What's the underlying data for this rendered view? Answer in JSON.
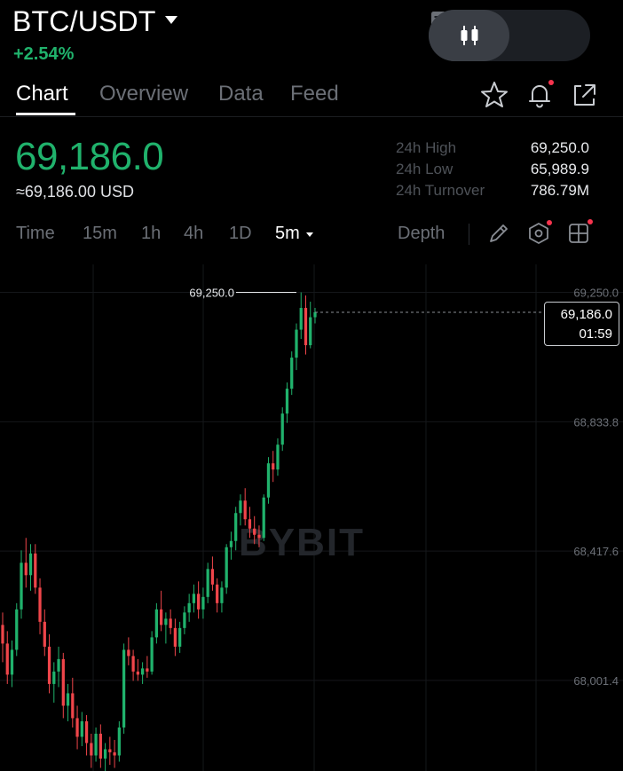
{
  "header": {
    "pair": "BTC/USDT",
    "change": "+2.54%",
    "view_toggle": {
      "left_icon": "candlestick-icon",
      "right_icon": "document-icon",
      "active": "left"
    }
  },
  "tabs": [
    {
      "label": "Chart",
      "active": true
    },
    {
      "label": "Overview",
      "active": false
    },
    {
      "label": "Data",
      "active": false
    },
    {
      "label": "Feed",
      "active": false
    }
  ],
  "header_icons": [
    "star-icon",
    "bell-icon",
    "share-icon"
  ],
  "ticker": {
    "last_price": "69,186.0",
    "usd_equiv": "≈69,186.00 USD",
    "stats": [
      {
        "label": "24h High",
        "value": "69,250.0"
      },
      {
        "label": "24h Low",
        "value": "65,989.9"
      },
      {
        "label": "24h Turnover",
        "value": "786.79M"
      }
    ]
  },
  "intervals": [
    {
      "label": "Time",
      "active": false
    },
    {
      "label": "15m",
      "active": false
    },
    {
      "label": "1h",
      "active": false
    },
    {
      "label": "4h",
      "active": false
    },
    {
      "label": "1D",
      "active": false
    },
    {
      "label": "5m",
      "active": true
    }
  ],
  "toolbar": {
    "depth_label": "Depth",
    "icons": [
      "pencil-icon",
      "indicator-icon",
      "layout-grid-icon"
    ]
  },
  "colors": {
    "up": "#20b26c",
    "down": "#ef454a",
    "accent_dot": "#f7344e"
  },
  "chart_data": {
    "type": "candlestick",
    "watermark": "BYBIT",
    "y_ticks": [
      "69,250.0",
      "68,833.8",
      "68,417.6",
      "68,001.4"
    ],
    "y_tick_values": [
      69250.0,
      68833.8,
      68417.6,
      68001.4
    ],
    "ylim": [
      67710,
      69340
    ],
    "high_marker": {
      "label": "69,250.0",
      "value": 69250.0
    },
    "current_price": {
      "price": "69,186.0",
      "value": 69186.0,
      "countdown": "01:59"
    },
    "candles": [
      [
        68180,
        68220,
        68060,
        68120
      ],
      [
        68120,
        68160,
        67990,
        68020
      ],
      [
        68020,
        68130,
        67980,
        68100
      ],
      [
        68100,
        68250,
        68080,
        68230
      ],
      [
        68230,
        68420,
        68200,
        68380
      ],
      [
        68380,
        68460,
        68300,
        68340
      ],
      [
        68340,
        68440,
        68290,
        68410
      ],
      [
        68410,
        68440,
        68280,
        68300
      ],
      [
        68300,
        68330,
        68150,
        68190
      ],
      [
        68190,
        68230,
        68080,
        68110
      ],
      [
        68110,
        68150,
        67960,
        67990
      ],
      [
        67990,
        68060,
        67930,
        68030
      ],
      [
        68030,
        68110,
        67980,
        68070
      ],
      [
        68070,
        68090,
        67880,
        67920
      ],
      [
        67920,
        67990,
        67870,
        67960
      ],
      [
        67960,
        68010,
        67850,
        67880
      ],
      [
        67880,
        67920,
        67780,
        67820
      ],
      [
        67820,
        67900,
        67790,
        67870
      ],
      [
        67870,
        67890,
        67760,
        67800
      ],
      [
        67800,
        67830,
        67720,
        67760
      ],
      [
        67760,
        67850,
        67740,
        67830
      ],
      [
        67830,
        67860,
        67720,
        67750
      ],
      [
        67750,
        67800,
        67700,
        67780
      ],
      [
        67780,
        67820,
        67730,
        67770
      ],
      [
        67770,
        67810,
        67720,
        67760
      ],
      [
        67760,
        67870,
        67740,
        67850
      ],
      [
        67850,
        68120,
        67830,
        68100
      ],
      [
        68100,
        68140,
        68050,
        68080
      ],
      [
        68080,
        68100,
        68000,
        68030
      ],
      [
        68030,
        68070,
        68000,
        68020
      ],
      [
        68020,
        68060,
        67990,
        68040
      ],
      [
        68040,
        68080,
        68010,
        68030
      ],
      [
        68030,
        68160,
        68020,
        68140
      ],
      [
        68140,
        68250,
        68120,
        68230
      ],
      [
        68230,
        68290,
        68160,
        68180
      ],
      [
        68180,
        68220,
        68120,
        68200
      ],
      [
        68200,
        68230,
        68150,
        68170
      ],
      [
        68170,
        68200,
        68080,
        68110
      ],
      [
        68110,
        68190,
        68090,
        68170
      ],
      [
        68170,
        68240,
        68150,
        68220
      ],
      [
        68220,
        68280,
        68190,
        68250
      ],
      [
        68250,
        68310,
        68220,
        68280
      ],
      [
        68280,
        68320,
        68200,
        68230
      ],
      [
        68230,
        68300,
        68200,
        68270
      ],
      [
        68270,
        68380,
        68250,
        68360
      ],
      [
        68360,
        68400,
        68290,
        68310
      ],
      [
        68310,
        68330,
        68220,
        68250
      ],
      [
        68250,
        68320,
        68220,
        68300
      ],
      [
        68300,
        68440,
        68280,
        68430
      ],
      [
        68430,
        68480,
        68390,
        68450
      ],
      [
        68450,
        68560,
        68420,
        68540
      ],
      [
        68540,
        68600,
        68500,
        68580
      ],
      [
        68580,
        68620,
        68500,
        68520
      ],
      [
        68520,
        68560,
        68460,
        68490
      ],
      [
        68490,
        68530,
        68440,
        68470
      ],
      [
        68470,
        68500,
        68430,
        68460
      ],
      [
        68460,
        68600,
        68450,
        68590
      ],
      [
        68590,
        68720,
        68570,
        68700
      ],
      [
        68700,
        68740,
        68640,
        68680
      ],
      [
        68680,
        68780,
        68660,
        68760
      ],
      [
        68760,
        68880,
        68740,
        68860
      ],
      [
        68860,
        68960,
        68830,
        68940
      ],
      [
        68940,
        69060,
        68920,
        69040
      ],
      [
        69040,
        69150,
        69000,
        69130
      ],
      [
        69130,
        69250,
        69100,
        69200
      ],
      [
        69200,
        69240,
        69050,
        69080
      ],
      [
        69080,
        69220,
        69070,
        69170
      ],
      [
        69170,
        69200,
        69150,
        69186
      ]
    ]
  }
}
